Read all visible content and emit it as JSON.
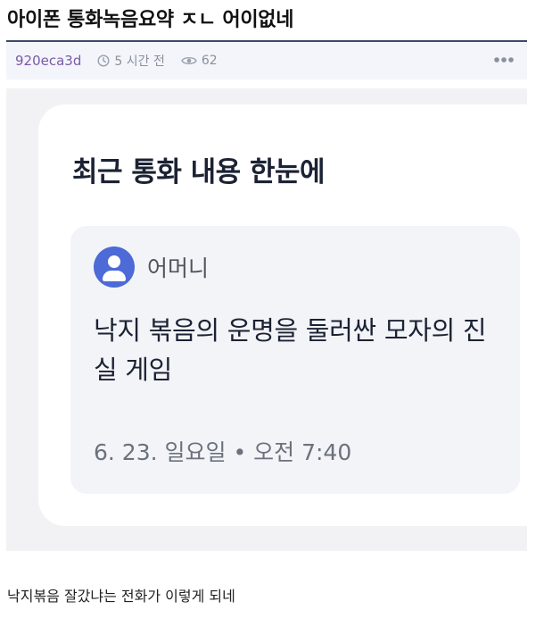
{
  "post": {
    "title": "아이폰 통화녹음요약 ㅈㄴ 어이없네",
    "author": "920eca3d",
    "time_ago": "5 시간 전",
    "views": "62",
    "body": "낙지볶음 잘갔냐는 전화가 이렇게 되네"
  },
  "screenshot": {
    "heading": "최근 통화 내용 한눈에",
    "contact_name": "어머니",
    "summary": "낙지 볶음의 운명을 둘러싼 모자의 진실 게임",
    "date_time": "6. 23. 일요일 • 오전 7:40"
  },
  "icons": {
    "time": "clock-icon",
    "views": "eye-icon",
    "more": "more-dots-icon",
    "avatar": "person-avatar-icon"
  },
  "colors": {
    "author": "#7a5aa6",
    "meta_border": "#3c4a6b",
    "avatar_bg": "#4d6ad6",
    "heading": "#1b2233"
  }
}
